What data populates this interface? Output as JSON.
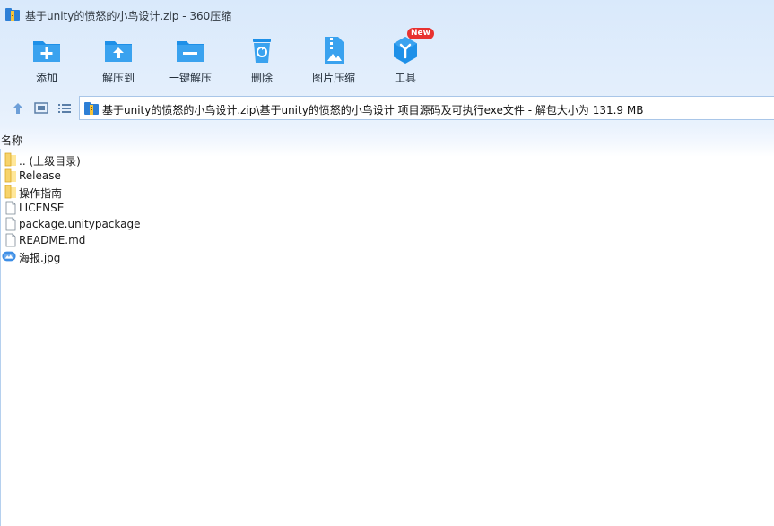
{
  "window": {
    "title": "基于unity的愤怒的小鸟设计.zip - 360压缩"
  },
  "toolbar": {
    "add": "添加",
    "extract_to": "解压到",
    "one_click_extract": "一键解压",
    "delete": "删除",
    "image_compress": "图片压缩",
    "tools": "工具",
    "new_badge": "New"
  },
  "address": {
    "path": "基于unity的愤怒的小鸟设计.zip\\基于unity的愤怒的小鸟设计 项目源码及可执行exe文件 - 解包大小为 131.9 MB"
  },
  "list": {
    "column_name": "名称",
    "items": [
      {
        "name": ".. (上级目录)",
        "type": "folder"
      },
      {
        "name": "Release",
        "type": "folder"
      },
      {
        "name": "操作指南",
        "type": "folder"
      },
      {
        "name": "LICENSE",
        "type": "file"
      },
      {
        "name": "package.unitypackage",
        "type": "file"
      },
      {
        "name": "README.md",
        "type": "file"
      },
      {
        "name": "海报.jpg",
        "type": "image"
      }
    ]
  },
  "colors": {
    "accent": "#1e90e8",
    "badge": "#e8312f"
  }
}
